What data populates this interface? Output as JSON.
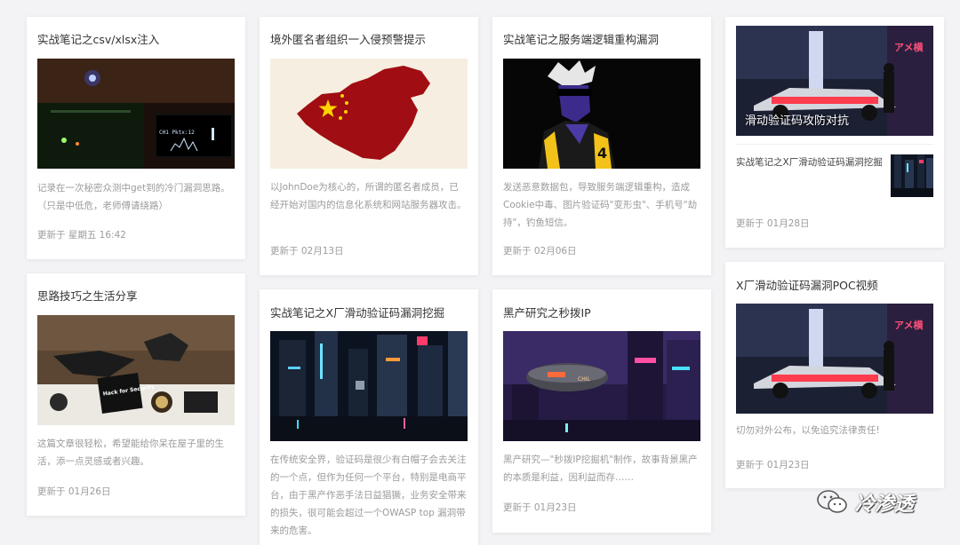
{
  "colors": {
    "page_background": "#f3f3f5",
    "card_background": "#ffffff",
    "title_text": "#333333",
    "muted_text": "#9b9b9b"
  },
  "cards": {
    "csv": {
      "title": "实战笔记之csv/xlsx注入",
      "desc": "记录在一次秘密众测中get到的冷门漏洞思路。（只是中低危，老师傅请绕路）",
      "date": "更新于 星期五 16:42"
    },
    "life": {
      "title": "思路技巧之生活分享",
      "desc": "这篇文章很轻松，希望能给你呆在屋子里的生活，添一点灵感或者兴趣。",
      "date": "更新于 01月26日",
      "sticker_text": "Hack for Security"
    },
    "johndoe": {
      "title": "境外匿名者组织一入侵预警提示",
      "desc": "以JohnDoe为核心的，所谓的匿名者成员，已经开始对国内的信息化系统和网站服务器攻击。",
      "date": "更新于 02月13日"
    },
    "captcha_mining": {
      "title": "实战笔记之X厂滑动验证码漏洞挖掘",
      "desc": "在传统安全界，验证码是很少有白帽子会去关注的一个点，但作为任何一个平台，特别是电商平台，由于黑产作恶手法日益猖獗，业务安全带来的损失，很可能会超过一个OWASP top 漏洞带来的危害。"
    },
    "logic": {
      "title": "实战笔记之服务端逻辑重构漏洞",
      "desc": "发送恶意数据包，导致服务端逻辑重构，造成Cookie中毒、图片验证码\"变形虫\"、手机号\"劫持\"，钓鱼短信。",
      "date": "更新于 02月06日"
    },
    "blackmarket": {
      "title": "黑产研究之秒拨IP",
      "desc": "黑产研究—\"秒拨IP挖掘机\"制作，故事背景黑产的本质是利益，因利益而存……",
      "date": "更新于 01月23日"
    },
    "featured": {
      "overlay_title": "滑动验证码攻防对抗",
      "item_title": "实战笔记之X厂滑动验证码漏洞挖掘",
      "date": "更新于 01月28日"
    },
    "poc": {
      "title": "X厂滑动验证码漏洞POC视频",
      "desc": "切勿对外公布，以免追究法律责任!",
      "date": "更新于 01月23日"
    }
  },
  "thumb_text": {
    "oscilloscope": "CH1 Pktx:12",
    "anime_badge": "4",
    "neon_sign": "アメ横",
    "bullet_label": "CHIL"
  },
  "watermark": {
    "icon": "wechat-icon",
    "text": "冷渗透"
  }
}
